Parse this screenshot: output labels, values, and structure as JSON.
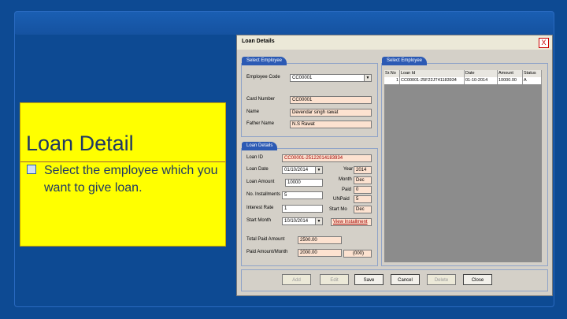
{
  "callout": {
    "title": "Loan Detail",
    "bullet": "Select the employee which you want to give loan."
  },
  "window": {
    "title": "Loan Details",
    "close": "X"
  },
  "select_employee": {
    "tab": "Select Employee",
    "code_label": "Employee Code",
    "code_value": "CC00001",
    "card_label": "Card Number",
    "card_value": "CC00001",
    "name_label": "Name",
    "name_value": "Devendar singh rawat",
    "father_label": "Father Name",
    "father_value": "N.S Rawat"
  },
  "select_employee_grid": {
    "tab": "Select Employee",
    "columns": [
      "Sr.No",
      "Loan Id",
      "Date",
      "Amount",
      "Status"
    ],
    "rows": [
      [
        "1",
        "CC00001-25F22JT41183934",
        "01-10-2014",
        "10000.00",
        "A"
      ]
    ]
  },
  "loan_details": {
    "tab": "Loan Details",
    "loan_id_label": "Loan ID",
    "loan_id_value": "CC00001-25122014183934",
    "loan_date_label": "Loan Date",
    "loan_date_value": "01/10/2014",
    "loan_amount_label": "Loan Amount",
    "loan_amount_value": "10000",
    "installments_label": "No. Installments",
    "installments_value": "5",
    "interest_label": "Interest Rate",
    "interest_value": "1",
    "start_month_label": "Start Month",
    "start_month_value": "10/10/2014",
    "year_label": "Year",
    "year_value": "2014",
    "month_label": "Month",
    "month_value": "Dec",
    "paid_label": "Paid",
    "paid_value": "0",
    "unpaid_label": "UNPaid",
    "unpaid_value": "5",
    "start_mo_label": "Start Mo",
    "start_mo_value": "Dec",
    "view_link": "View Installment",
    "total_paid_label": "Total Paid Amount",
    "total_paid_value": "2500.00",
    "paid_month_label": "Paid Amount/Month",
    "paid_month_value": "2000.00",
    "small_btn": "(000)"
  },
  "buttons": [
    "Add",
    "Edit",
    "Save",
    "Cancel",
    "Delete",
    "Close"
  ]
}
